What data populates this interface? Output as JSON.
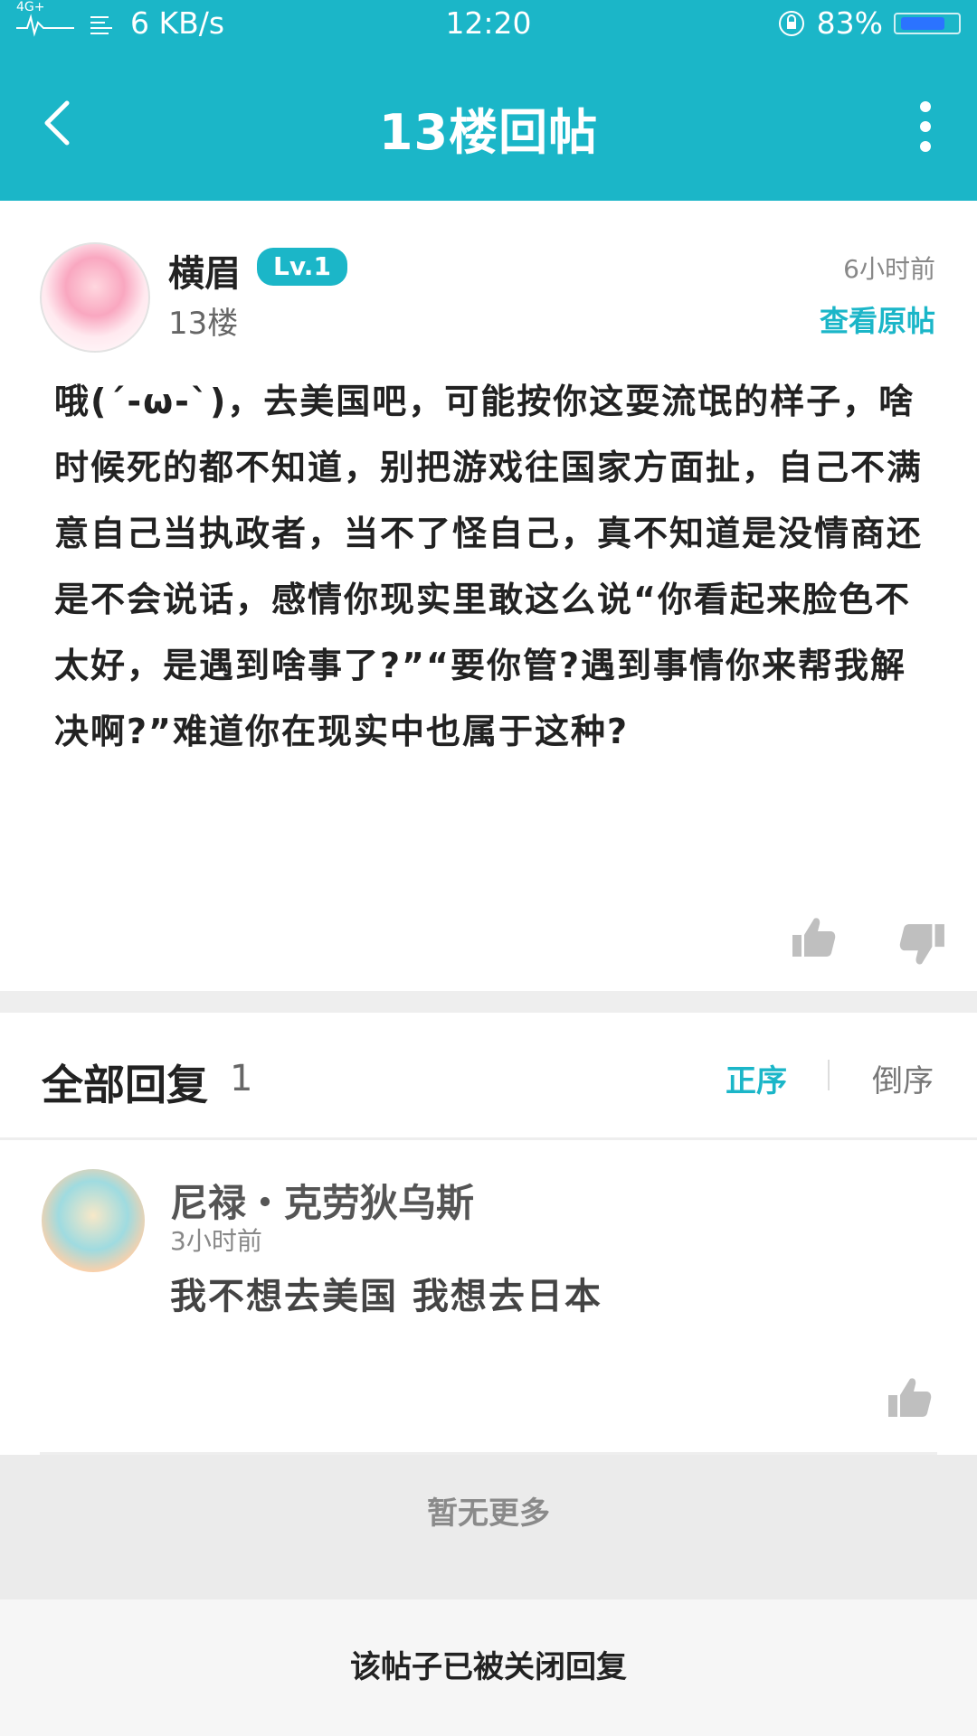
{
  "status_bar": {
    "network": "4G+",
    "speed": "6 KB/s",
    "time": "12:20",
    "battery": "83%",
    "battery_level": 0.83
  },
  "nav": {
    "title": "13楼回帖"
  },
  "post": {
    "username": "横眉",
    "level": "Lv.1",
    "floor": "13楼",
    "time": "6小时前",
    "view_original": "查看原帖",
    "content": "哦(´-ω-`)，去美国吧，可能按你这耍流氓的样子，啥时候死的都不知道，别把游戏往国家方面扯，自己不满意自己当执政者，当不了怪自己，真不知道是没情商还是不会说话，感情你现实里敢这么说“你看起来脸色不太好，是遇到啥事了?”“要你管?遇到事情你来帮我解决啊?”难道你在现实中也属于这种?"
  },
  "replies_header": {
    "title": "全部回复",
    "count": "1",
    "sort_asc": "正序",
    "sort_desc": "倒序"
  },
  "reply": {
    "name": "尼禄・克劳狄乌斯",
    "time": "3小时前",
    "text": "我不想去美国 我想去日本"
  },
  "footer": {
    "no_more": "暂无更多",
    "closed_notice": "该帖子已被关闭回复"
  },
  "colors": {
    "accent": "#1bb6c8",
    "background": "#ffffff",
    "divider": "#eeeeee"
  },
  "icons": {
    "back": "chevron-left-icon",
    "more": "more-vertical-icon",
    "like": "thumbs-up-icon",
    "dislike": "thumbs-down-icon"
  }
}
